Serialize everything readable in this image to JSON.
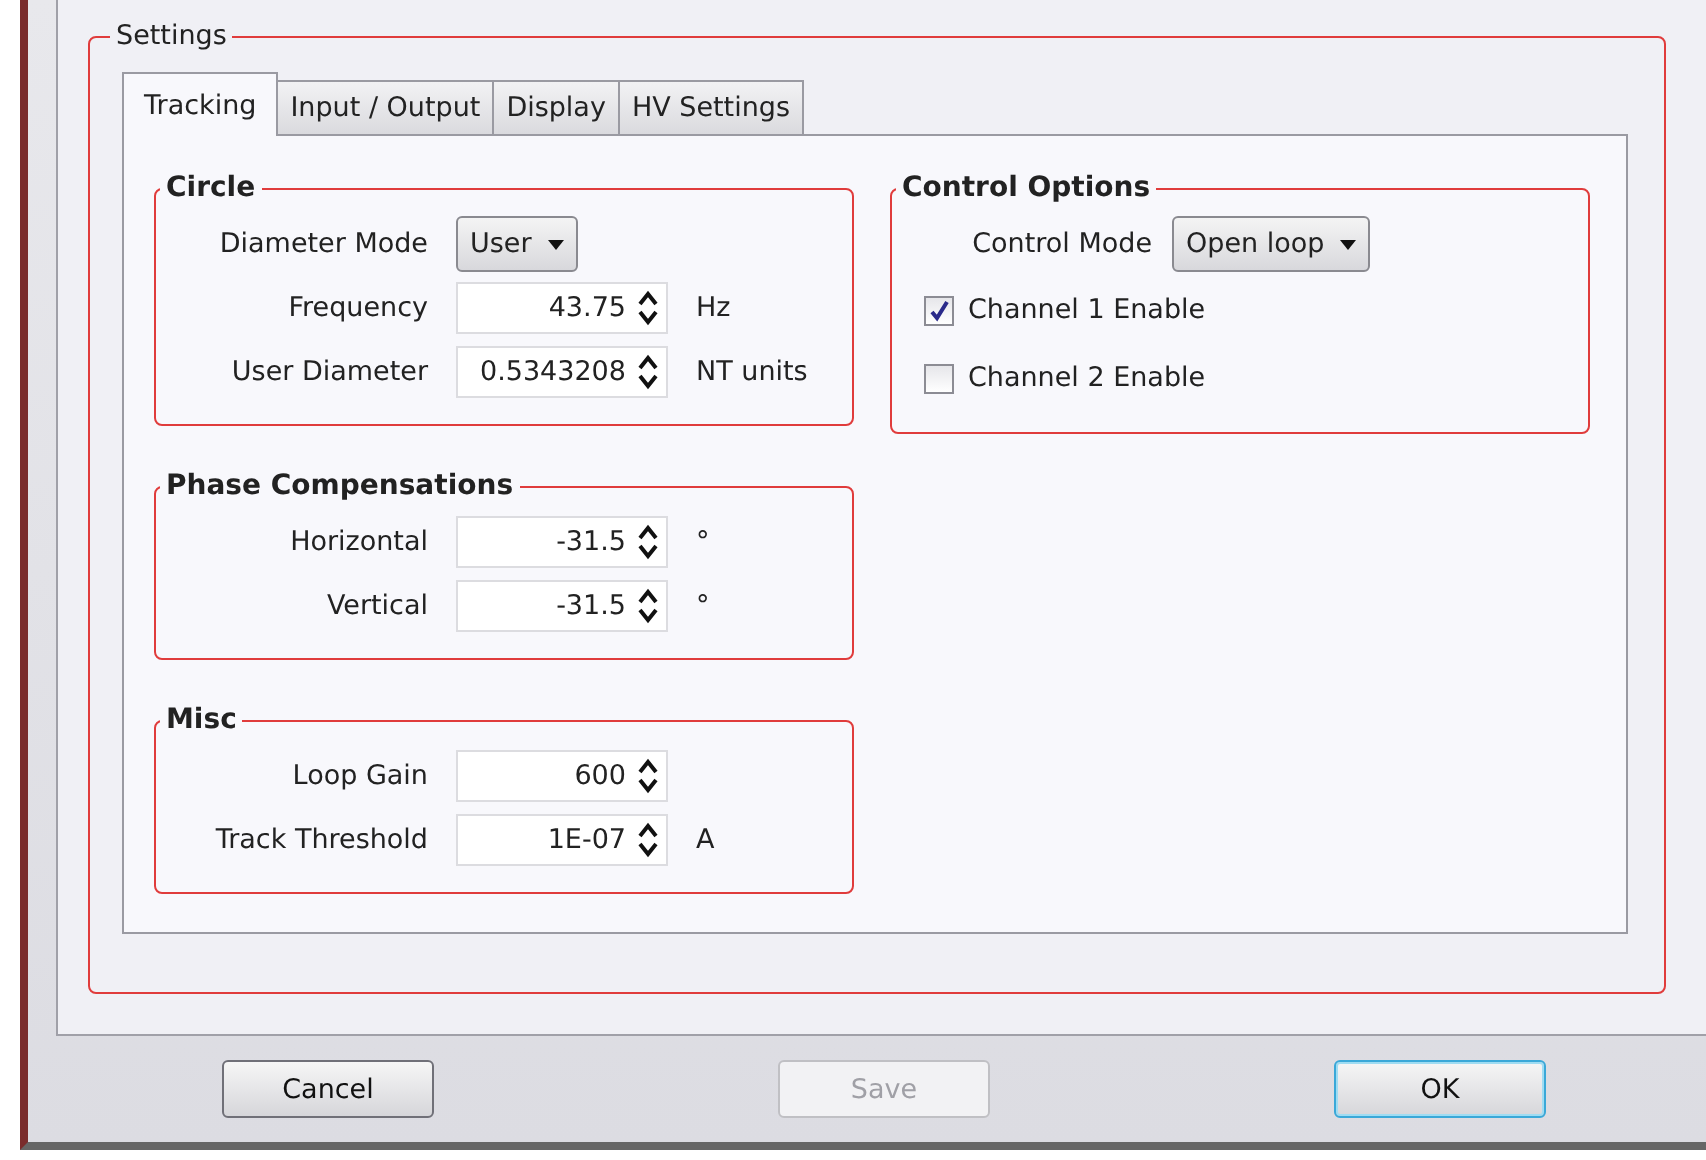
{
  "settings": {
    "title": "Settings"
  },
  "tabs": [
    {
      "label": "Tracking",
      "selected": true
    },
    {
      "label": "Input / Output",
      "selected": false
    },
    {
      "label": "Display",
      "selected": false
    },
    {
      "label": "HV Settings",
      "selected": false
    }
  ],
  "columns": [
    {
      "groups": [
        {
          "title": "Circle",
          "rows": [
            {
              "kind": "dropdown",
              "label": "Diameter Mode",
              "value": "User"
            },
            {
              "kind": "spin",
              "label": "Frequency",
              "value": "43.75",
              "unit": "Hz"
            },
            {
              "kind": "spin",
              "label": "User Diameter",
              "value": "0.5343208",
              "unit": "NT units"
            }
          ]
        },
        {
          "title": "Phase Compensations",
          "rows": [
            {
              "kind": "spin",
              "label": "Horizontal",
              "value": "-31.5",
              "unit": "°"
            },
            {
              "kind": "spin",
              "label": "Vertical",
              "value": "-31.5",
              "unit": "°"
            }
          ]
        },
        {
          "title": "Misc",
          "rows": [
            {
              "kind": "spin",
              "label": "Loop Gain",
              "value": "600"
            },
            {
              "kind": "spin",
              "label": "Track Threshold",
              "value": "1E-07",
              "unit": "A"
            }
          ]
        }
      ]
    },
    {
      "groups": [
        {
          "title": "Control Options",
          "rows": [
            {
              "kind": "dropdown",
              "label": "Control Mode",
              "value": "Open loop"
            },
            {
              "kind": "checkbox",
              "label": "Channel 1 Enable",
              "checked": true
            },
            {
              "kind": "checkbox",
              "label": "Channel 2 Enable",
              "checked": false
            }
          ]
        }
      ]
    }
  ],
  "buttons": [
    {
      "label": "Cancel",
      "disabled": false,
      "focused": false
    },
    {
      "label": "Save",
      "disabled": true,
      "focused": false
    },
    {
      "label": "OK",
      "disabled": false,
      "focused": true
    }
  ]
}
